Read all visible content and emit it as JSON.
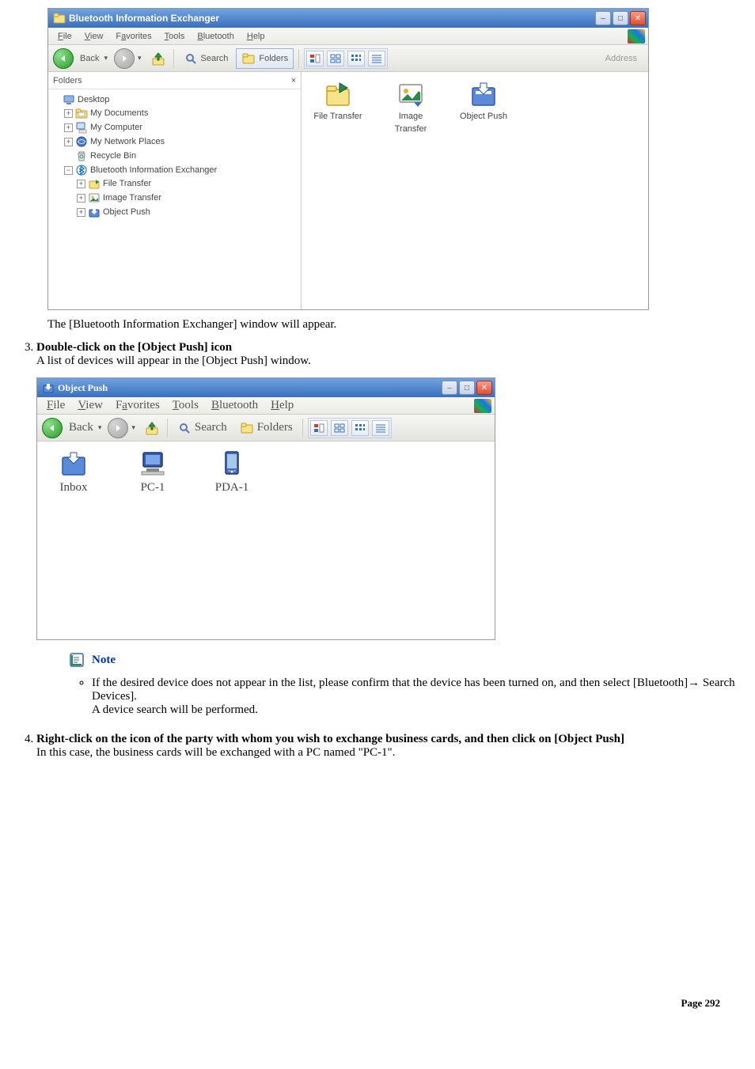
{
  "win1": {
    "title": "Bluetooth Information Exchanger",
    "menu": [
      "File",
      "View",
      "Favorites",
      "Tools",
      "Bluetooth",
      "Help"
    ],
    "menu_accel": [
      "F",
      "V",
      "a",
      "T",
      "B",
      "H"
    ],
    "back": "Back",
    "search": "Search",
    "folders": "Folders",
    "address": "Address",
    "folders_pane_title": "Folders",
    "close_x": "×",
    "tree": {
      "desktop": "Desktop",
      "mydocs": "My Documents",
      "mycomp": "My Computer",
      "mynet": "My Network Places",
      "recycle": "Recycle Bin",
      "bie": "Bluetooth Information Exchanger",
      "filetrans": "File Transfer",
      "imgtrans": "Image Transfer",
      "objpush": "Object Push"
    },
    "items": {
      "filetrans": "File Transfer",
      "imgtrans": "Image\nTransfer",
      "imgtrans_l1": "Image",
      "imgtrans_l2": "Transfer",
      "objpush": "Object Push"
    }
  },
  "caption1": "The [Bluetooth Information Exchanger] window will appear.",
  "step3": {
    "title": "Double-click on the [Object Push] icon",
    "body": "A list of devices will appear in the [Object Push] window."
  },
  "win2": {
    "title": "Object Push",
    "menu": [
      "File",
      "View",
      "Favorites",
      "Tools",
      "Bluetooth",
      "Help"
    ],
    "menu_accel": [
      "F",
      "V",
      "a",
      "T",
      "B",
      "H"
    ],
    "back": "Back",
    "search": "Search",
    "folders": "Folders",
    "items": {
      "inbox": "Inbox",
      "pc1": "PC-1",
      "pda1": "PDA-1"
    }
  },
  "note": {
    "label": "Note",
    "body1": "If the desired device does not appear in the list, please confirm that the device has been turned on, and then select [Bluetooth]→ Search Devices].",
    "body2": "A device search will be performed."
  },
  "step4": {
    "title": "Right-click on the icon of the party with whom you wish to exchange business cards, and then click on [Object Push]",
    "body": "In this case, the business cards will be exchanged with a PC named \"PC-1\"."
  },
  "footer": "Page 292"
}
